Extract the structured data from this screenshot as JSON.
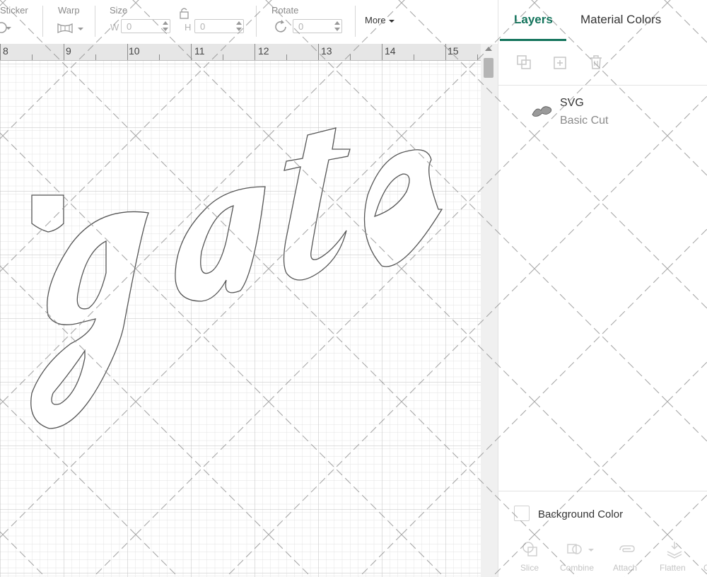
{
  "toolbar": {
    "sticker_label": "Sticker",
    "warp_label": "Warp",
    "size_label": "Size",
    "width_letter": "W",
    "width_value": "0",
    "height_letter": "H",
    "height_value": "0",
    "rotate_label": "Rotate",
    "rotate_value": "0",
    "more_label": "More"
  },
  "ruler": {
    "numbers": [
      "8",
      "9",
      "10",
      "11",
      "12",
      "13",
      "14",
      "15"
    ]
  },
  "canvas": {
    "design_text": "gate"
  },
  "panel": {
    "tabs": [
      {
        "label": "Layers",
        "active": true
      },
      {
        "label": "Material Colors",
        "active": false
      }
    ],
    "layer": {
      "name": "SVG",
      "type": "Basic Cut"
    },
    "background_color_label": "Background Color",
    "bottom_tools": [
      "Slice",
      "Combine",
      "Attach",
      "Flatten",
      "C"
    ]
  },
  "colors": {
    "accent": "#12735b"
  }
}
